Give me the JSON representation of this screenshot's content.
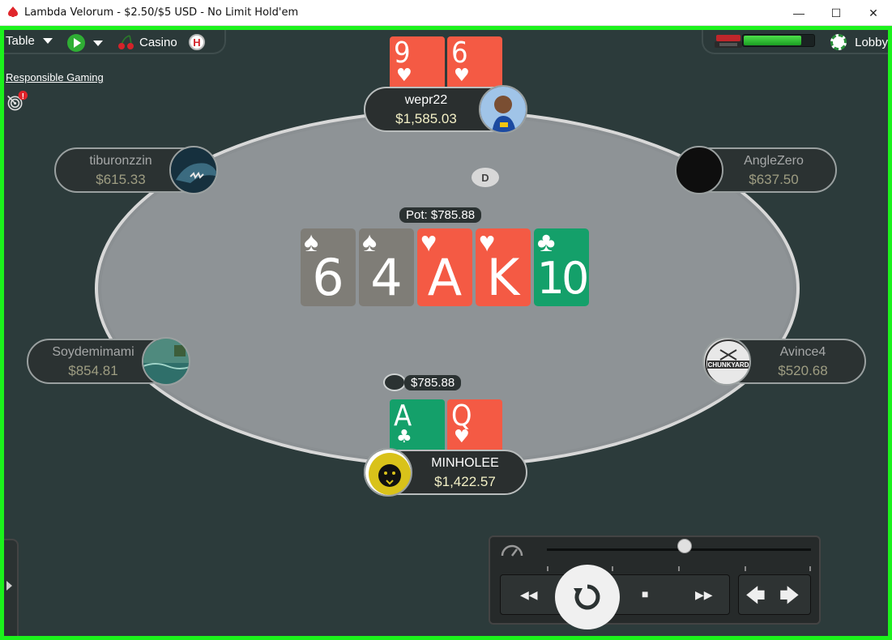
{
  "window": {
    "title": "Lambda Velorum - $2.50/$5 USD - No Limit Hold'em",
    "minimize": "—",
    "maximize": "☐",
    "close": "✕"
  },
  "toolbar": {
    "table_label": "Table",
    "casino_label": "Casino",
    "h_badge": "H",
    "lobby_label": "Lobby",
    "timebank_level": 0.82
  },
  "responsible_gaming": {
    "label": "Responsible Gaming",
    "alert": "!"
  },
  "seats": [
    {
      "id": "top",
      "name": "wepr22",
      "stack": "$1,585.03",
      "state": "active"
    },
    {
      "id": "upper-left",
      "name": "tiburonzzin",
      "stack": "$615.33",
      "state": "dim"
    },
    {
      "id": "upper-right",
      "name": "AngleZero",
      "stack": "$637.50",
      "state": "dim"
    },
    {
      "id": "lower-left",
      "name": "Soydemimami",
      "stack": "$854.81",
      "state": "dim"
    },
    {
      "id": "lower-right",
      "name": "Avince4",
      "stack": "$520.68",
      "state": "dim"
    },
    {
      "id": "hero",
      "name": "MINHOLEE",
      "stack": "$1,422.57",
      "state": "active"
    }
  ],
  "hole_cards": {
    "top": [
      {
        "rank": "9",
        "suit": "♥",
        "color": "heart"
      },
      {
        "rank": "6",
        "suit": "♥",
        "color": "heart"
      }
    ],
    "hero": [
      {
        "rank": "A",
        "suit": "♣",
        "color": "club"
      },
      {
        "rank": "Q",
        "suit": "♥",
        "color": "heart"
      }
    ]
  },
  "board": [
    {
      "rank": "6",
      "suit": "♠",
      "color": "spade"
    },
    {
      "rank": "4",
      "suit": "♠",
      "color": "spade"
    },
    {
      "rank": "A",
      "suit": "♥",
      "color": "heart"
    },
    {
      "rank": "K",
      "suit": "♥",
      "color": "heart"
    },
    {
      "rank": "10",
      "suit": "♣",
      "color": "club"
    }
  ],
  "pot": {
    "label": "Pot: $785.88"
  },
  "bet": {
    "amount": "$785.88"
  },
  "dealer_button": "D",
  "avatar_labels": {
    "avince4": "CHUNKYARD"
  },
  "replayer": {
    "slider_position": 0.52,
    "rewind": "◀◀",
    "stop": "■",
    "forward": "▶▶",
    "prev": "🡄",
    "next": "🡆"
  },
  "colors": {
    "frame_border": "#1cf21c",
    "felt": "#8e9396",
    "heart": "#f45a44",
    "spade": "#7f7d77",
    "club": "#14a06a"
  }
}
